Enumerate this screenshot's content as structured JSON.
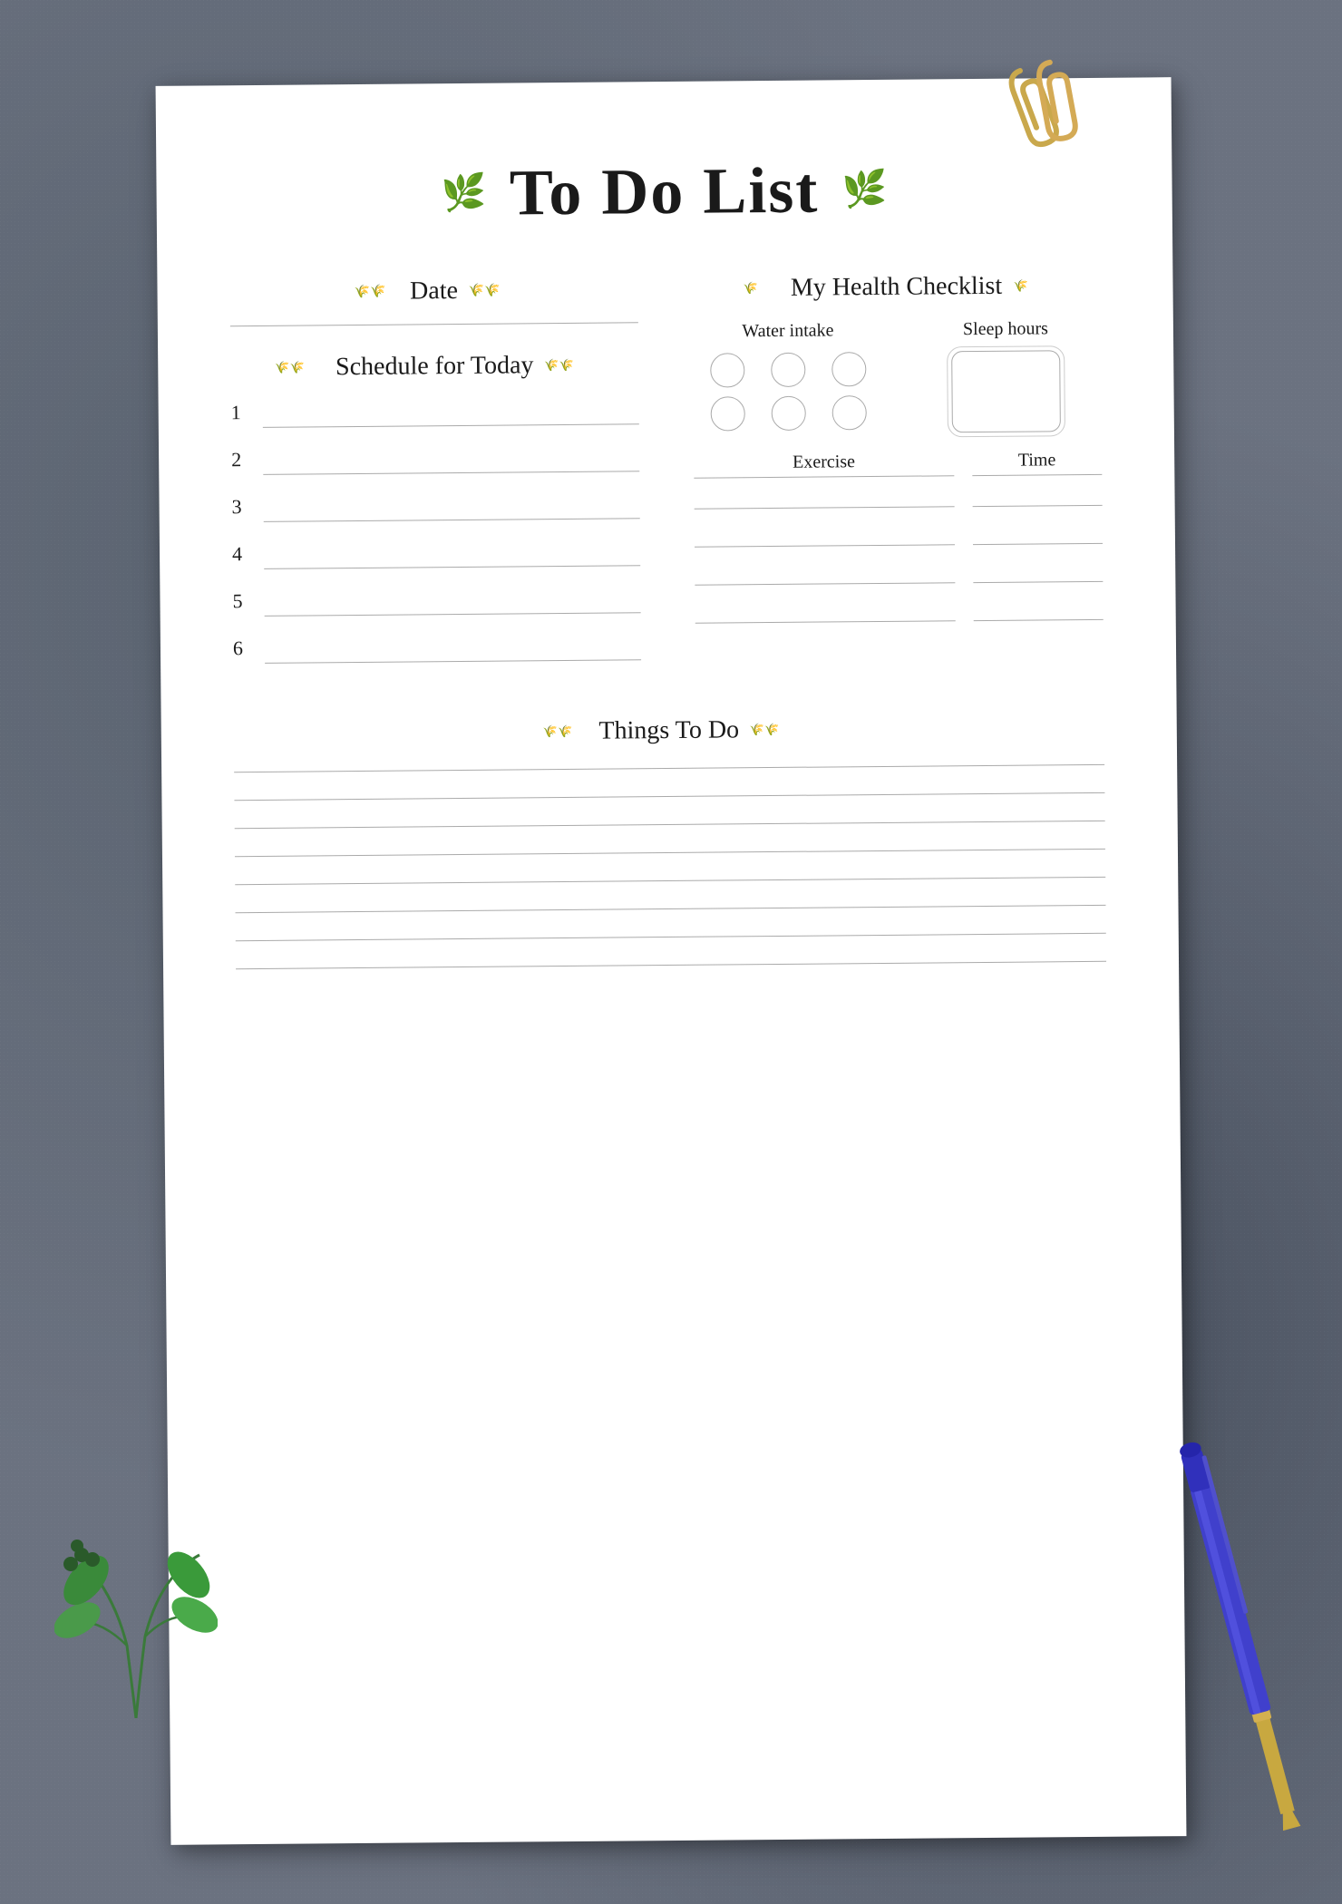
{
  "page": {
    "title": "To Do List",
    "background_color": "#6b7280"
  },
  "sections": {
    "date": {
      "label": "Date"
    },
    "schedule": {
      "label": "Schedule for Today",
      "items": [
        "1",
        "2",
        "3",
        "4",
        "5",
        "6"
      ]
    },
    "health": {
      "label": "My Health Checklist",
      "water_label": "Water intake",
      "sleep_label": "Sleep hours",
      "exercise_label": "Exercise",
      "time_label": "Time",
      "water_circles": 6,
      "exercise_rows": 4
    },
    "things": {
      "label": "Things To Do",
      "lines": 8
    }
  },
  "decorations": {
    "leaf_left": "❧",
    "leaf_right": "❧"
  }
}
